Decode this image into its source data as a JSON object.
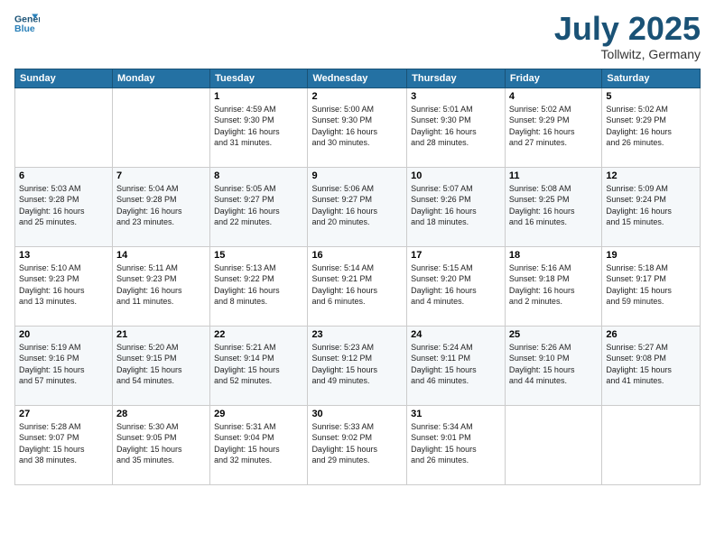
{
  "header": {
    "logo_line1": "General",
    "logo_line2": "Blue",
    "month": "July 2025",
    "location": "Tollwitz, Germany"
  },
  "weekdays": [
    "Sunday",
    "Monday",
    "Tuesday",
    "Wednesday",
    "Thursday",
    "Friday",
    "Saturday"
  ],
  "weeks": [
    [
      {
        "day": "",
        "info": ""
      },
      {
        "day": "",
        "info": ""
      },
      {
        "day": "1",
        "info": "Sunrise: 4:59 AM\nSunset: 9:30 PM\nDaylight: 16 hours\nand 31 minutes."
      },
      {
        "day": "2",
        "info": "Sunrise: 5:00 AM\nSunset: 9:30 PM\nDaylight: 16 hours\nand 30 minutes."
      },
      {
        "day": "3",
        "info": "Sunrise: 5:01 AM\nSunset: 9:30 PM\nDaylight: 16 hours\nand 28 minutes."
      },
      {
        "day": "4",
        "info": "Sunrise: 5:02 AM\nSunset: 9:29 PM\nDaylight: 16 hours\nand 27 minutes."
      },
      {
        "day": "5",
        "info": "Sunrise: 5:02 AM\nSunset: 9:29 PM\nDaylight: 16 hours\nand 26 minutes."
      }
    ],
    [
      {
        "day": "6",
        "info": "Sunrise: 5:03 AM\nSunset: 9:28 PM\nDaylight: 16 hours\nand 25 minutes."
      },
      {
        "day": "7",
        "info": "Sunrise: 5:04 AM\nSunset: 9:28 PM\nDaylight: 16 hours\nand 23 minutes."
      },
      {
        "day": "8",
        "info": "Sunrise: 5:05 AM\nSunset: 9:27 PM\nDaylight: 16 hours\nand 22 minutes."
      },
      {
        "day": "9",
        "info": "Sunrise: 5:06 AM\nSunset: 9:27 PM\nDaylight: 16 hours\nand 20 minutes."
      },
      {
        "day": "10",
        "info": "Sunrise: 5:07 AM\nSunset: 9:26 PM\nDaylight: 16 hours\nand 18 minutes."
      },
      {
        "day": "11",
        "info": "Sunrise: 5:08 AM\nSunset: 9:25 PM\nDaylight: 16 hours\nand 16 minutes."
      },
      {
        "day": "12",
        "info": "Sunrise: 5:09 AM\nSunset: 9:24 PM\nDaylight: 16 hours\nand 15 minutes."
      }
    ],
    [
      {
        "day": "13",
        "info": "Sunrise: 5:10 AM\nSunset: 9:23 PM\nDaylight: 16 hours\nand 13 minutes."
      },
      {
        "day": "14",
        "info": "Sunrise: 5:11 AM\nSunset: 9:23 PM\nDaylight: 16 hours\nand 11 minutes."
      },
      {
        "day": "15",
        "info": "Sunrise: 5:13 AM\nSunset: 9:22 PM\nDaylight: 16 hours\nand 8 minutes."
      },
      {
        "day": "16",
        "info": "Sunrise: 5:14 AM\nSunset: 9:21 PM\nDaylight: 16 hours\nand 6 minutes."
      },
      {
        "day": "17",
        "info": "Sunrise: 5:15 AM\nSunset: 9:20 PM\nDaylight: 16 hours\nand 4 minutes."
      },
      {
        "day": "18",
        "info": "Sunrise: 5:16 AM\nSunset: 9:18 PM\nDaylight: 16 hours\nand 2 minutes."
      },
      {
        "day": "19",
        "info": "Sunrise: 5:18 AM\nSunset: 9:17 PM\nDaylight: 15 hours\nand 59 minutes."
      }
    ],
    [
      {
        "day": "20",
        "info": "Sunrise: 5:19 AM\nSunset: 9:16 PM\nDaylight: 15 hours\nand 57 minutes."
      },
      {
        "day": "21",
        "info": "Sunrise: 5:20 AM\nSunset: 9:15 PM\nDaylight: 15 hours\nand 54 minutes."
      },
      {
        "day": "22",
        "info": "Sunrise: 5:21 AM\nSunset: 9:14 PM\nDaylight: 15 hours\nand 52 minutes."
      },
      {
        "day": "23",
        "info": "Sunrise: 5:23 AM\nSunset: 9:12 PM\nDaylight: 15 hours\nand 49 minutes."
      },
      {
        "day": "24",
        "info": "Sunrise: 5:24 AM\nSunset: 9:11 PM\nDaylight: 15 hours\nand 46 minutes."
      },
      {
        "day": "25",
        "info": "Sunrise: 5:26 AM\nSunset: 9:10 PM\nDaylight: 15 hours\nand 44 minutes."
      },
      {
        "day": "26",
        "info": "Sunrise: 5:27 AM\nSunset: 9:08 PM\nDaylight: 15 hours\nand 41 minutes."
      }
    ],
    [
      {
        "day": "27",
        "info": "Sunrise: 5:28 AM\nSunset: 9:07 PM\nDaylight: 15 hours\nand 38 minutes."
      },
      {
        "day": "28",
        "info": "Sunrise: 5:30 AM\nSunset: 9:05 PM\nDaylight: 15 hours\nand 35 minutes."
      },
      {
        "day": "29",
        "info": "Sunrise: 5:31 AM\nSunset: 9:04 PM\nDaylight: 15 hours\nand 32 minutes."
      },
      {
        "day": "30",
        "info": "Sunrise: 5:33 AM\nSunset: 9:02 PM\nDaylight: 15 hours\nand 29 minutes."
      },
      {
        "day": "31",
        "info": "Sunrise: 5:34 AM\nSunset: 9:01 PM\nDaylight: 15 hours\nand 26 minutes."
      },
      {
        "day": "",
        "info": ""
      },
      {
        "day": "",
        "info": ""
      }
    ]
  ]
}
